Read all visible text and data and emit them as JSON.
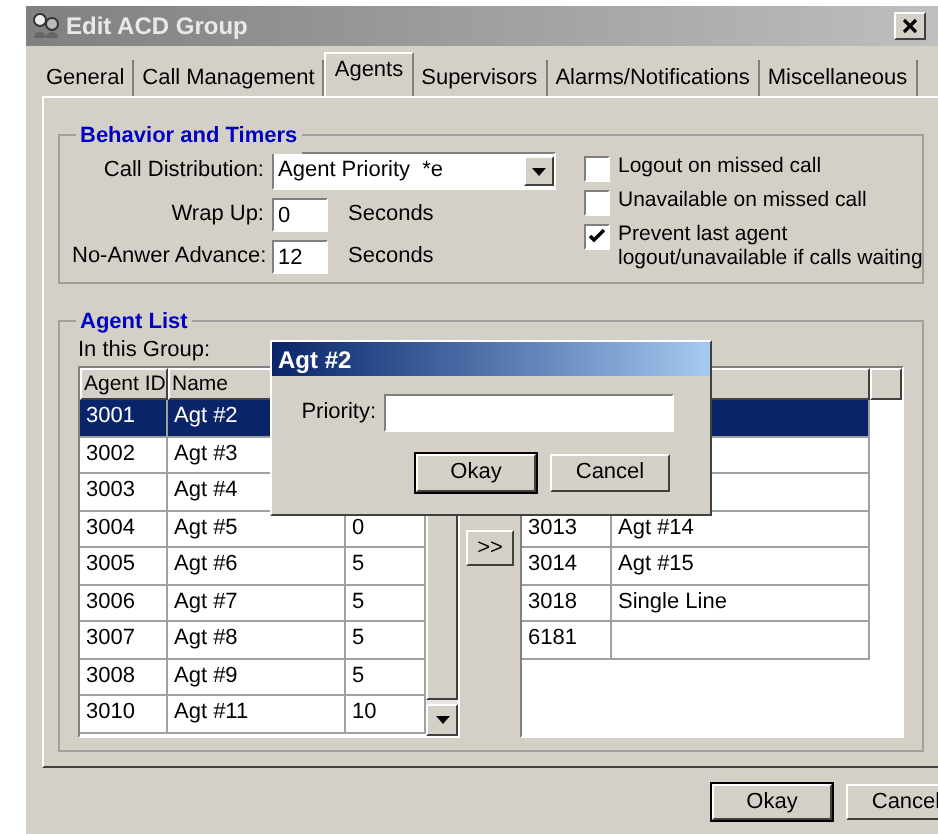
{
  "window": {
    "title": "Edit ACD Group"
  },
  "tabs": [
    {
      "label": "General",
      "selected": false
    },
    {
      "label": "Call Management",
      "selected": false
    },
    {
      "label": "Agents",
      "selected": true
    },
    {
      "label": "Supervisors",
      "selected": false
    },
    {
      "label": "Alarms/Notifications",
      "selected": false
    },
    {
      "label": "Miscellaneous",
      "selected": false
    }
  ],
  "behavior": {
    "title": "Behavior and Timers",
    "call_distribution": {
      "label": "Call Distribution:",
      "value": "Agent Priority  *e"
    },
    "timers": [
      {
        "label": "Wrap Up:",
        "value": "0",
        "unit": "Seconds"
      },
      {
        "label": "No-Anwer Advance:",
        "value": "12",
        "unit": "Seconds"
      }
    ],
    "checkboxes": [
      {
        "label": "Logout on missed call",
        "checked": false
      },
      {
        "label": "Unavailable on missed call",
        "checked": false
      },
      {
        "label": "Prevent last agent logout/unavailable if calls waiting",
        "checked": true
      }
    ]
  },
  "agent_list": {
    "title": "Agent List",
    "in_group_label": "In this Group:",
    "in_group_columns": [
      "Agent ID",
      "Name"
    ],
    "in_group_rows": [
      {
        "cells": [
          "3001",
          "Agt #2"
        ],
        "selected": true
      },
      {
        "cells": [
          "3002",
          "Agt #3"
        ],
        "selected": false
      },
      {
        "cells": [
          "3003",
          "Agt #4"
        ],
        "selected": false
      },
      {
        "cells": [
          "3004",
          "Agt #5",
          "0"
        ],
        "selected": false
      },
      {
        "cells": [
          "3005",
          "Agt #6",
          "5"
        ],
        "selected": false
      },
      {
        "cells": [
          "3006",
          "Agt #7",
          "5"
        ],
        "selected": false
      },
      {
        "cells": [
          "3007",
          "Agt #8",
          "5"
        ],
        "selected": false
      },
      {
        "cells": [
          "3008",
          "Agt #9",
          "5"
        ],
        "selected": false
      },
      {
        "cells": [
          "3010",
          "Agt #11",
          "10"
        ],
        "selected": false
      }
    ],
    "add_button": ">>",
    "available_rows": [
      {
        "selected": true
      },
      {
        "selected": false
      },
      {
        "selected": false
      },
      {
        "cells": [
          "3013",
          "Agt #14"
        ],
        "selected": false
      },
      {
        "cells": [
          "3014",
          "Agt #15"
        ],
        "selected": false
      },
      {
        "cells": [
          "3018",
          "Single Line"
        ],
        "selected": false
      },
      {
        "cells": [
          "6181"
        ],
        "selected": false
      }
    ]
  },
  "buttons": [
    "Okay",
    "Cancel"
  ],
  "popup": {
    "title": "Agt #2",
    "field_label": "Priority:",
    "buttons": [
      "Okay",
      "Cancel"
    ]
  }
}
